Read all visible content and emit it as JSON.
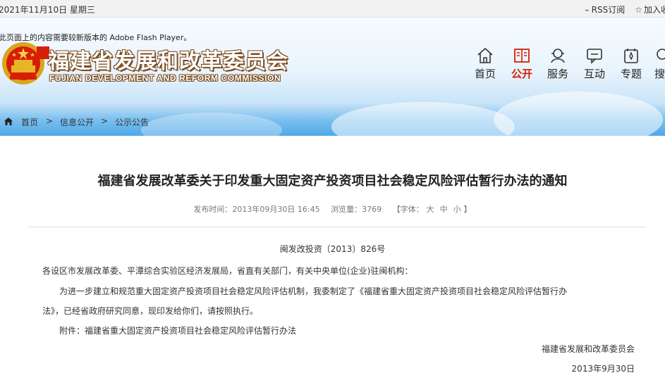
{
  "topbar": {
    "date": "2021年11月10日 星期三",
    "rss_label": "RSS订阅",
    "bookmark_label": "加入收"
  },
  "banner": {
    "flash_notice": "此页面上的内容需要较新版本的 Adobe Flash Player。",
    "site_title_cn": "福建省发展和改革委员会",
    "site_title_en": "FUJIAN DEVELOPMENT AND REFORM COMMISSION"
  },
  "nav": {
    "items": [
      {
        "label": "首页",
        "icon": "home-icon"
      },
      {
        "label": "公开",
        "icon": "book-icon",
        "active": true
      },
      {
        "label": "服务",
        "icon": "service-icon"
      },
      {
        "label": "互动",
        "icon": "chat-icon"
      },
      {
        "label": "专题",
        "icon": "topic-icon"
      },
      {
        "label": "搜",
        "icon": "search-icon"
      }
    ]
  },
  "breadcrumb": {
    "items": [
      "首页",
      "信息公开",
      "公示公告"
    ],
    "separator": ">"
  },
  "article": {
    "title": "福建省发展改革委关于印发重大固定资产投资项目社会稳定风险评估暂行办法的通知",
    "meta": {
      "published_label": "发布时间：",
      "published_value": "2013年09月30日 16:45",
      "views_label": "浏览量：",
      "views_value": "3769",
      "font_label": "【字体：",
      "font_large": "大",
      "font_medium": "中",
      "font_small": "小",
      "font_close": "】"
    },
    "doc_number": "闽发改投资〔2013〕826号",
    "salutation": "各设区市发展改革委、平潭综合实验区经济发展局，省直有关部门，有关中央单位(企业)驻闽机构：",
    "paragraph_line1": "为进一步建立和规范重大固定资产投资项目社会稳定风险评估机制，我委制定了《福建省重大固定资产投资项目社会稳定风险评估暂行办",
    "paragraph_line2": "法》，已经省政府研究同意，现印发给你们，请按照执行。",
    "attachment": "附件：福建省重大固定资产投资项目社会稳定风险评估暂行办法",
    "signature": "福建省发展和改革委员会",
    "sign_date": "2013年9月30日"
  },
  "colors": {
    "accent_red": "#d81e06",
    "banner_blue": "#4ea9e8"
  }
}
